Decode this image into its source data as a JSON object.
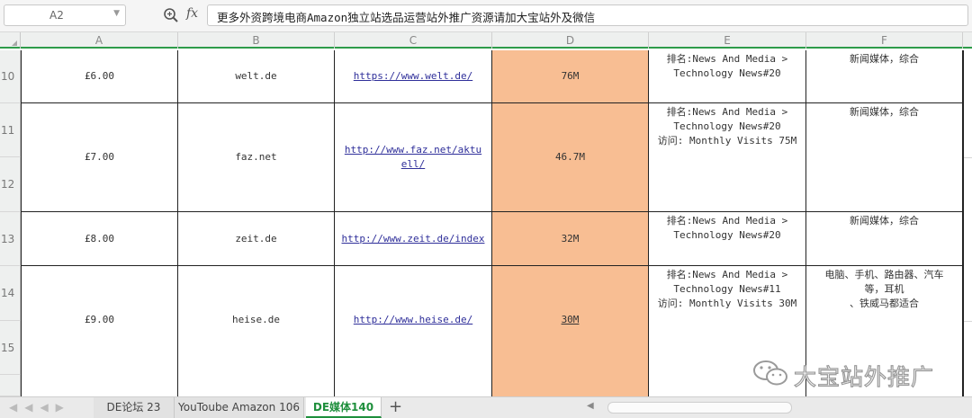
{
  "formula_bar": {
    "name_box": "A2",
    "fx_label": "fx",
    "content": "更多外资跨境电商Amazon独立站选品运营站外推广资源请加大宝站外及微信"
  },
  "columns": [
    "A",
    "B",
    "C",
    "D",
    "E",
    "F"
  ],
  "rows": [
    {
      "num": "10",
      "price": "£6.00",
      "domain": "welt.de",
      "url": "https://www.welt.de/",
      "visits": "76M",
      "rank_lines": [
        "排名:News And Media >",
        "Technology News#20"
      ],
      "category_lines": [
        "新闻媒体，综合"
      ]
    },
    {
      "num": "11",
      "num2": "12",
      "price": "£7.00",
      "domain": "faz.net",
      "url_lines": [
        "http://www.faz.net/aktu",
        "ell/"
      ],
      "visits": "46.7M",
      "rank_lines": [
        "排名:News And Media >",
        "Technology News#20",
        "访问: Monthly Visits 75M"
      ],
      "category_lines": [
        "新闻媒体，综合"
      ]
    },
    {
      "num": "13",
      "price": "£8.00",
      "domain": "zeit.de",
      "url": "http://www.zeit.de/index",
      "visits": "32M",
      "rank_lines": [
        "排名:News And Media >",
        "Technology News#20"
      ],
      "category_lines": [
        "新闻媒体，综合"
      ]
    },
    {
      "num": "14",
      "num2": "15",
      "price": "£9.00",
      "domain": "heise.de",
      "url": "http://www.heise.de/",
      "visits": "30M",
      "rank_lines": [
        "排名:News And Media >",
        "Technology News#11",
        "访问: Monthly Visits 30M"
      ],
      "category_lines": [
        "电脑、手机、路由器、汽车",
        "等，耳机",
        "、铁威马都适合"
      ]
    }
  ],
  "tabs": [
    "DE论坛 23",
    "YouToube Amazon 106",
    "DE媒体140"
  ],
  "tab_add": "+",
  "watermark": "大宝站外推广",
  "colors": {
    "accent": "#1e8f3c",
    "highlight": "#f8be93"
  }
}
